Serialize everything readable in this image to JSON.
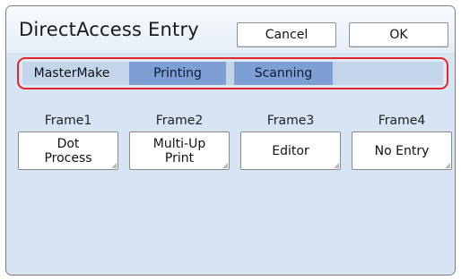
{
  "dialog": {
    "title": "DirectAccess Entry",
    "cancel_label": "Cancel",
    "ok_label": "OK"
  },
  "tabs": [
    {
      "label": "MasterMake",
      "active": true
    },
    {
      "label": "Printing",
      "active": false
    },
    {
      "label": "Scanning",
      "active": false
    }
  ],
  "frames": [
    {
      "label": "Frame1",
      "button": "Dot\nProcess"
    },
    {
      "label": "Frame2",
      "button": "Multi-Up\nPrint"
    },
    {
      "label": "Frame3",
      "button": "Editor"
    },
    {
      "label": "Frame4",
      "button": "No Entry"
    }
  ],
  "colors": {
    "highlight_border": "#e2262a",
    "tab_inactive": "#7d9fd3",
    "tab_active": "#c4d5ea"
  }
}
